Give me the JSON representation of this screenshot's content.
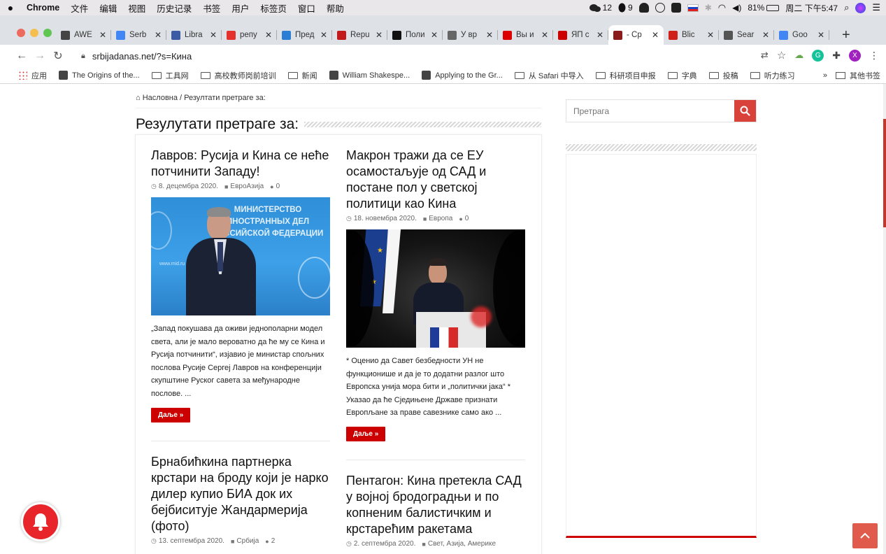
{
  "menubar": {
    "app": "Chrome",
    "items": [
      "文件",
      "编辑",
      "视图",
      "历史记录",
      "书签",
      "用户",
      "标签页",
      "窗口",
      "帮助"
    ],
    "wechat_count": "12",
    "qq_count": "9",
    "battery": "81%",
    "clock": "周二 下午5:47"
  },
  "tabs": [
    {
      "title": "AWE",
      "icon": "camera-icon",
      "color": "#444"
    },
    {
      "title": "Serb",
      "icon": "google-icon",
      "color": "#4285f4"
    },
    {
      "title": "Libra",
      "icon": "library-icon",
      "color": "#3b5ba5"
    },
    {
      "title": "репу",
      "icon": "yandex-icon",
      "color": "#e5312b"
    },
    {
      "title": "Пред",
      "icon": "dot-icon",
      "color": "#2a7fd4"
    },
    {
      "title": "Repu",
      "icon": "h-icon",
      "color": "#c21a1a"
    },
    {
      "title": "Поли",
      "icon": "bracket-icon",
      "color": "#111"
    },
    {
      "title": "У вр",
      "icon": "tile-icon",
      "color": "#666"
    },
    {
      "title": "Вы и",
      "icon": "r-icon",
      "color": "#d00"
    },
    {
      "title": "ЯП с",
      "icon": "yap-icon",
      "color": "#c00"
    },
    {
      "title": "- Ср",
      "icon": "tree-icon",
      "color": "#8b1c1c"
    },
    {
      "title": "Blic",
      "icon": "blic-icon",
      "color": "#d0201a"
    },
    {
      "title": "Sear",
      "icon": "globe-icon",
      "color": "#555"
    },
    {
      "title": "Goo",
      "icon": "translate-icon",
      "color": "#4285f4"
    }
  ],
  "address": {
    "url": "srbijadanas.net/?s=Кина"
  },
  "bookmarks": [
    {
      "label": "应用",
      "kind": "apps"
    },
    {
      "label": "The Origins of the...",
      "kind": "site"
    },
    {
      "label": "工具网",
      "kind": "folder"
    },
    {
      "label": "高校教师岗前培训",
      "kind": "folder"
    },
    {
      "label": "新闻",
      "kind": "folder"
    },
    {
      "label": "William Shakespe...",
      "kind": "site"
    },
    {
      "label": "Applying to the Gr...",
      "kind": "site"
    },
    {
      "label": "从 Safari 中导入",
      "kind": "folder"
    },
    {
      "label": "科研项目申报",
      "kind": "folder"
    },
    {
      "label": "字典",
      "kind": "folder"
    },
    {
      "label": "投稿",
      "kind": "folder"
    },
    {
      "label": "听力练习",
      "kind": "folder"
    }
  ],
  "bookmarks_more": "»",
  "bookmarks_other": "其他书签",
  "page": {
    "breadcrumb_home": "Насловна",
    "breadcrumb_sep": " / ",
    "breadcrumb_current": "Резултати претраге за:",
    "title": "Резулутати претраге за:",
    "search_placeholder": "Претрага"
  },
  "posts": [
    {
      "title": "Лавров: Русија и Кина се неће потчинити Западу!",
      "date": "8. децембра 2020.",
      "category": "ЕвроАзија",
      "comments": "0",
      "excerpt": "„Запад покушава да оживи једнополарни модел света, али је мало вероватно да ће му се Кина и Русија потчинити“, изјавио је министар спољних послова Русије Сергеј Лавров на конференцији скупштине Руског савета за међународне послове. ...",
      "more": "Даље »"
    },
    {
      "title": "Макрон тражи да се ЕУ осамостаљује од САД и постане пол у светској политици као Кина",
      "date": "18. новембра 2020.",
      "category": "Европа",
      "comments": "0",
      "excerpt": "* Оценио да Савет безбедности УН не функционише и да је то додатни разлог што Европска унија мора бити и „политички јака“ * Указао да ће Сједињене Државе признати Европљане за праве савезнике само ако ...",
      "more": "Даље »"
    },
    {
      "title": "Брнабићкина партнерка крстари на броду који је нарко дилер купио БИА док их бејбиситује Жандармерија (фото)",
      "date": "13. септембра 2020.",
      "category": "Србија",
      "comments": "2"
    },
    {
      "title": "Пентагон: Кина претекла САД у војној бродоградњи и по копненим балистичким и крстарећим ракетама",
      "date": "2. септембра 2020.",
      "category": "Свет, Азија, Америке"
    }
  ],
  "image_texts": {
    "lavrov_banner": "МИНИСТЕРСТВО ИНОСТРАННЫХ ДЕЛ РОССИЙСКОЙ ФЕДЕРАЦИИ",
    "lavrov_url": "www.mid.ru"
  },
  "colors": {
    "accent": "#cc0000",
    "search_button": "#d9423b",
    "totop": "#e05b4b",
    "bell": "#e9252c"
  }
}
